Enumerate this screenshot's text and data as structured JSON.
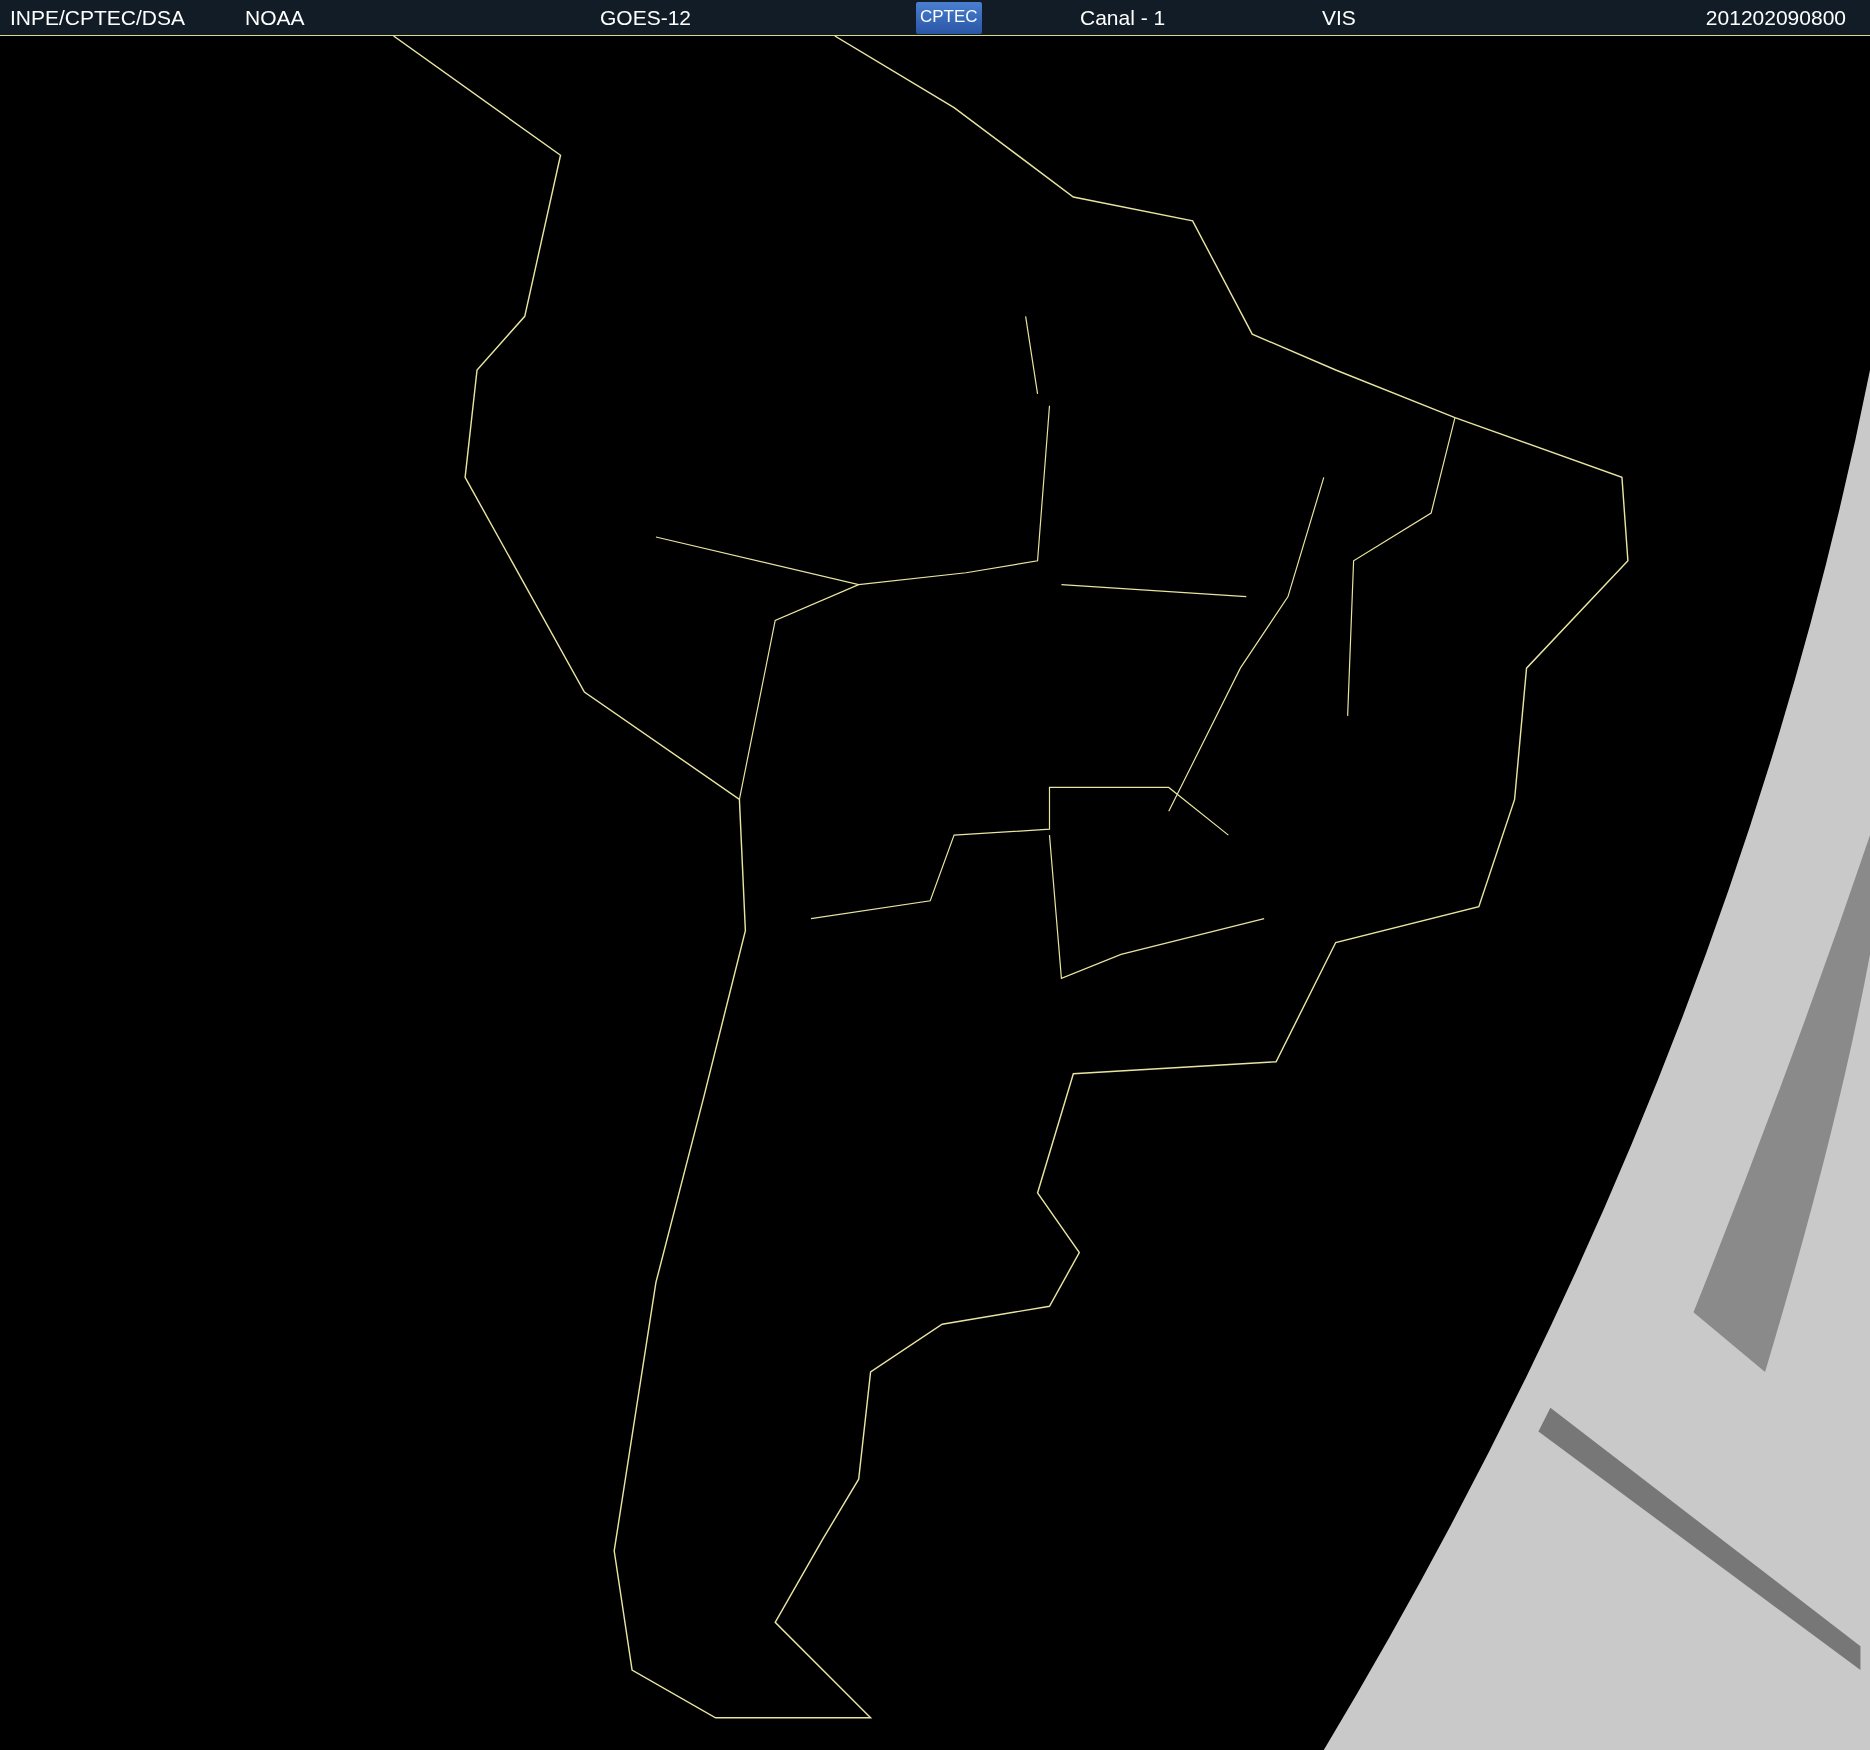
{
  "header": {
    "items": [
      {
        "kind": "text",
        "text": "INPE/CPTEC/DSA"
      },
      {
        "kind": "text",
        "text": "NOAA"
      },
      {
        "kind": "text",
        "text": "GOES-12"
      },
      {
        "kind": "logo",
        "text": "CPTEC"
      },
      {
        "kind": "text",
        "text": "Canal - 1"
      },
      {
        "kind": "text",
        "text": "VIS"
      },
      {
        "kind": "text",
        "text": "201202090800"
      }
    ]
  }
}
